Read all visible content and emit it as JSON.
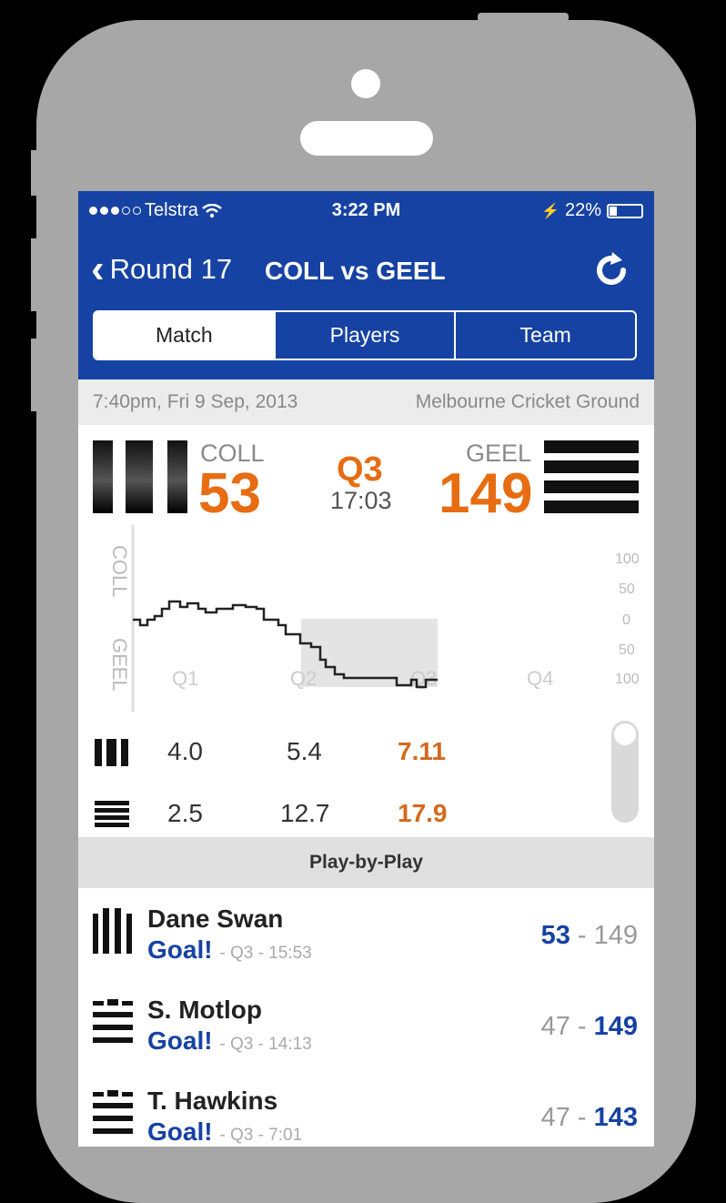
{
  "status": {
    "carrier": "Telstra",
    "time": "3:22 PM",
    "battery": "22%"
  },
  "nav": {
    "back_label": "Round 17",
    "title": "COLL vs GEEL"
  },
  "tabs": [
    {
      "label": "Match",
      "active": true
    },
    {
      "label": "Players",
      "active": false
    },
    {
      "label": "Team",
      "active": false
    }
  ],
  "match": {
    "datetime": "7:40pm, Fri 9 Sep, 2013",
    "venue": "Melbourne Cricket Ground"
  },
  "score": {
    "home": {
      "abbr": "COLL",
      "score": "53"
    },
    "away": {
      "abbr": "GEEL",
      "score": "149"
    },
    "quarter": "Q3",
    "clock": "17:03"
  },
  "graph": {
    "top_label": "COLL",
    "bottom_label": "GEEL",
    "quarters": [
      "Q1",
      "Q2",
      "Q3",
      "Q4"
    ],
    "y_ticks": [
      "100",
      "50",
      "0",
      "50",
      "100"
    ]
  },
  "totals": {
    "home": [
      "4.0",
      "5.4",
      "7.11"
    ],
    "away": [
      "2.5",
      "12.7",
      "17.9"
    ]
  },
  "pbp": {
    "title": "Play-by-Play",
    "items": [
      {
        "player": "Dane Swan",
        "event": "Goal!",
        "meta": "- Q3 - 15:53",
        "home_score": "53",
        "away_score": "149",
        "team": "home"
      },
      {
        "player": "S. Motlop",
        "event": "Goal!",
        "meta": "- Q3 - 14:13",
        "home_score": "47",
        "away_score": "149",
        "team": "away"
      },
      {
        "player": "T. Hawkins",
        "event": "Goal!",
        "meta": "- Q3 - 7:01",
        "home_score": "47",
        "away_score": "143",
        "team": "away"
      }
    ]
  },
  "colors": {
    "header_blue": "#1642a3",
    "score_orange": "#e76c12"
  }
}
